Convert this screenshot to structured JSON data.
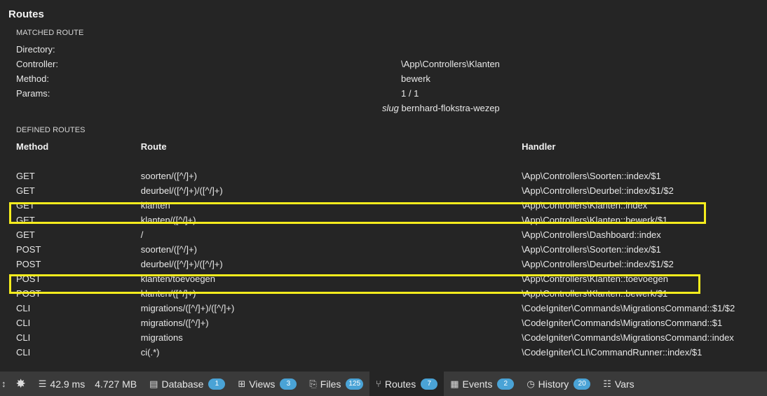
{
  "panel": {
    "title": "Routes",
    "matched_label": "MATCHED ROUTE",
    "matched": {
      "directory_key": "Directory:",
      "directory_val": "",
      "controller_key": "Controller:",
      "controller_val": "\\App\\Controllers\\Klanten",
      "method_key": "Method:",
      "method_val": "bewerk",
      "params_key": "Params:",
      "params_val": "1 / 1",
      "param_name": "slug",
      "param_value": "bernhard-flokstra-wezep"
    },
    "defined_label": "DEFINED ROUTES",
    "columns": {
      "method": "Method",
      "route": "Route",
      "handler": "Handler"
    },
    "routes": [
      {
        "method": "GET",
        "route": "soorten/([^/]+)",
        "handler": "\\App\\Controllers\\Soorten::index/$1"
      },
      {
        "method": "GET",
        "route": "deurbel/([^/]+)/([^/]+)",
        "handler": "\\App\\Controllers\\Deurbel::index/$1/$2"
      },
      {
        "method": "GET",
        "route": "klanten",
        "handler": "\\App\\Controllers\\Klanten::index"
      },
      {
        "method": "GET",
        "route": "klanten/([^/]+)",
        "handler": "\\App\\Controllers\\Klanten::bewerk/$1"
      },
      {
        "method": "GET",
        "route": "/",
        "handler": "\\App\\Controllers\\Dashboard::index"
      },
      {
        "method": "POST",
        "route": "soorten/([^/]+)",
        "handler": "\\App\\Controllers\\Soorten::index/$1"
      },
      {
        "method": "POST",
        "route": "deurbel/([^/]+)/([^/]+)",
        "handler": "\\App\\Controllers\\Deurbel::index/$1/$2"
      },
      {
        "method": "POST",
        "route": "klanten/toevoegen",
        "handler": "\\App\\Controllers\\Klanten::toevoegen"
      },
      {
        "method": "POST",
        "route": "klanten/([^/]+)",
        "handler": "\\App\\Controllers\\Klanten::bewerk/$1"
      },
      {
        "method": "CLI",
        "route": "migrations/([^/]+)/([^/]+)",
        "handler": "\\CodeIgniter\\Commands\\MigrationsCommand::$1/$2"
      },
      {
        "method": "CLI",
        "route": "migrations/([^/]+)",
        "handler": "\\CodeIgniter\\Commands\\MigrationsCommand::$1"
      },
      {
        "method": "CLI",
        "route": "migrations",
        "handler": "\\CodeIgniter\\Commands\\MigrationsCommand::index"
      },
      {
        "method": "CLI",
        "route": "ci(.*)",
        "handler": "\\CodeIgniter\\CLI\\CommandRunner::index/$1"
      }
    ]
  },
  "toolbar": {
    "time": "42.9 ms",
    "memory": "4.727 MB",
    "items": [
      {
        "label": "Database",
        "count": "1"
      },
      {
        "label": "Views",
        "count": "3"
      },
      {
        "label": "Files",
        "count": "125"
      },
      {
        "label": "Routes",
        "count": "7"
      },
      {
        "label": "Events",
        "count": "2"
      },
      {
        "label": "History",
        "count": "20"
      },
      {
        "label": "Vars",
        "count": ""
      }
    ]
  },
  "colors": {
    "highlight": "#f5ec1d",
    "badge": "#4aa3d6",
    "background": "#252525",
    "toolbar": "#3a3a3a"
  }
}
